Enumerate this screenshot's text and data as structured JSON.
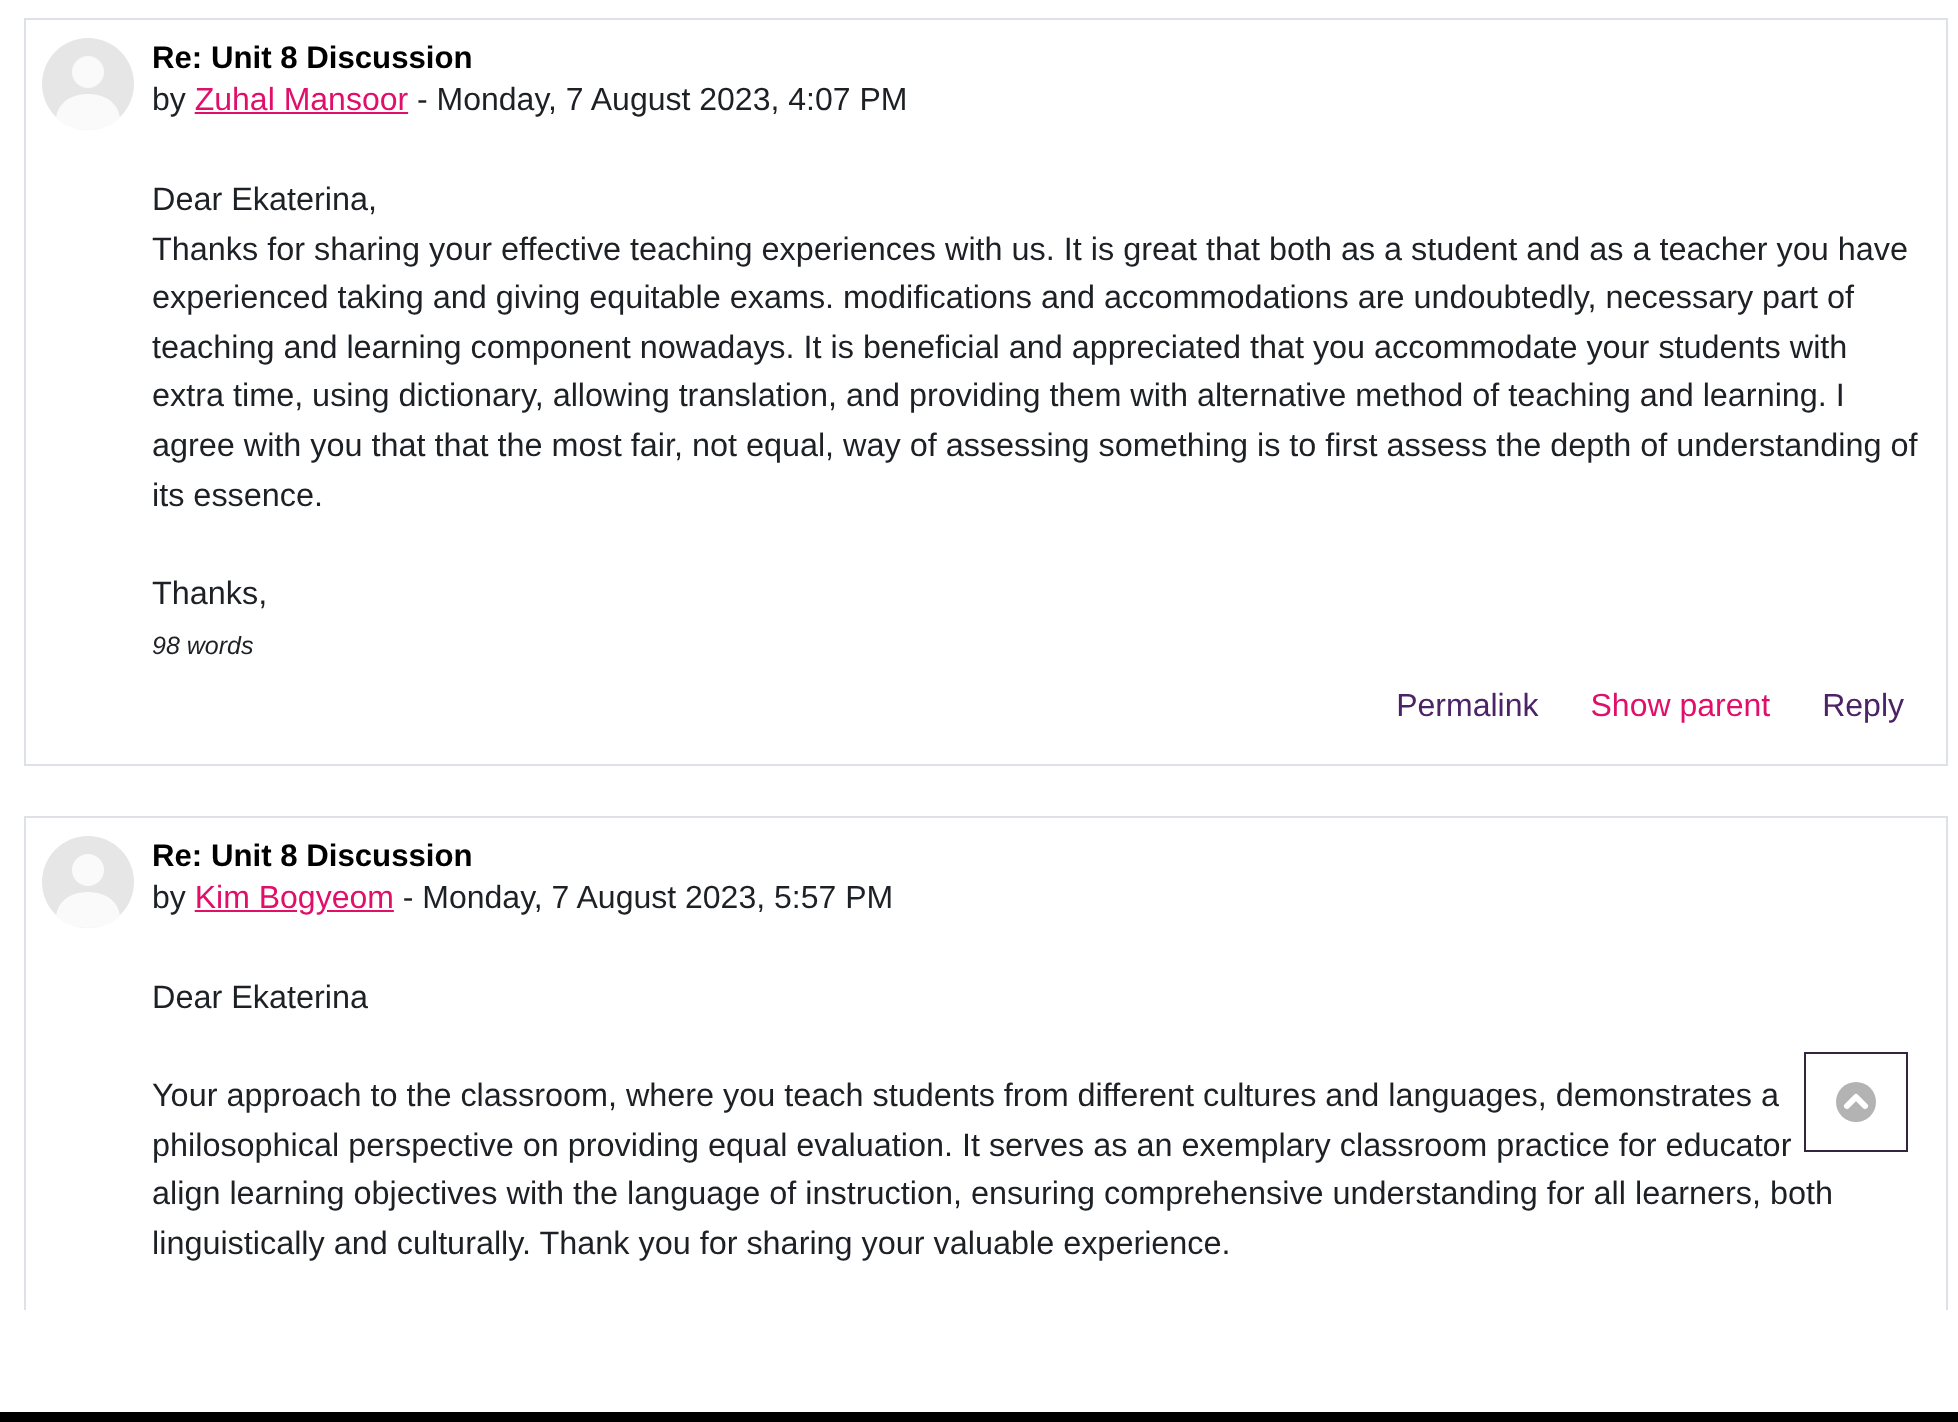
{
  "posts": [
    {
      "subject": "Re: Unit 8 Discussion",
      "byline": {
        "prefix": "by",
        "author": "Zuhal Mansoor",
        "suffix": "- Monday, 7 August 2023, 4:07 PM"
      },
      "paragraphs": [
        [
          "Dear Ekaterina,",
          "Thanks for sharing your effective teaching experiences with us. It is great that both as a student and as a teacher you have experienced taking and giving equitable exams. modifications and accommodations are undoubtedly, necessary part of teaching and learning component nowadays. It is beneficial and appreciated that you accommodate your students with extra time, using dictionary, allowing translation, and providing them with alternative method of teaching and learning. I agree with you that that the most fair, not equal, way of assessing something is to first assess the depth of understanding of its essence."
        ],
        [
          "Thanks,"
        ]
      ],
      "word_count": "98 words",
      "actions": [
        {
          "label": "Permalink",
          "visited": true
        },
        {
          "label": "Show parent",
          "visited": false
        },
        {
          "label": "Reply",
          "visited": true
        }
      ]
    },
    {
      "subject": "Re: Unit 8 Discussion",
      "byline": {
        "prefix": "by",
        "author": "Kim Bogyeom",
        "suffix": "- Monday, 7 August 2023, 5:57 PM"
      },
      "paragraphs": [
        [
          "Dear Ekaterina"
        ],
        [
          "Your approach to the classroom, where you teach students from different cultures and languages, demonstrates a",
          "philosophical perspective on providing equal evaluation. It serves as an exemplary classroom practice for educator",
          "align learning objectives with the language of instruction, ensuring comprehensive understanding for all learners, both",
          "linguistically and culturally. Thank you for sharing your valuable experience."
        ]
      ]
    }
  ]
}
